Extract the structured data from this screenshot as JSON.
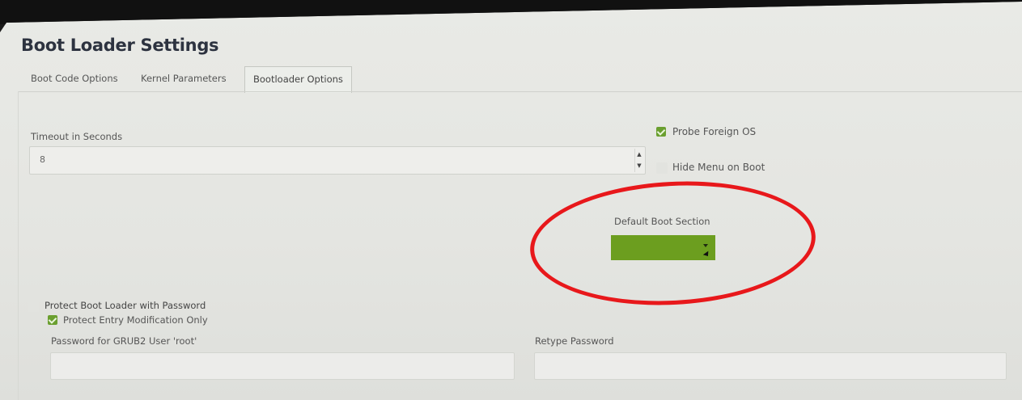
{
  "window": {
    "title": "Boot Loader Settings"
  },
  "tabs": [
    {
      "label": "Boot Code Options",
      "active": false
    },
    {
      "label": "Kernel Parameters",
      "active": false
    },
    {
      "label": "Bootloader Options",
      "active": true
    }
  ],
  "timeout": {
    "label": "Timeout in Seconds",
    "value": "8"
  },
  "probe_foreign_os": {
    "label": "Probe Foreign OS",
    "checked": true
  },
  "hide_menu": {
    "label": "Hide Menu on Boot",
    "checked": false
  },
  "default_boot_section": {
    "label": "Default Boot Section",
    "value": ""
  },
  "protect_password": {
    "label": "Protect Boot Loader with Password",
    "checked": false
  },
  "protect_entry": {
    "label": "Protect Entry Modification Only",
    "checked": true
  },
  "password_field": {
    "label": "Password for GRUB2 User 'root'",
    "value": ""
  },
  "retype_field": {
    "label": "Retype Password",
    "value": ""
  },
  "colors": {
    "accent": "#6c9e1f",
    "annotation": "#e8181b"
  },
  "icons": {
    "spin": "spinner-arrows-icon",
    "dropdown": "triangle-down-icon",
    "cursor": "mouse-pointer-icon"
  }
}
